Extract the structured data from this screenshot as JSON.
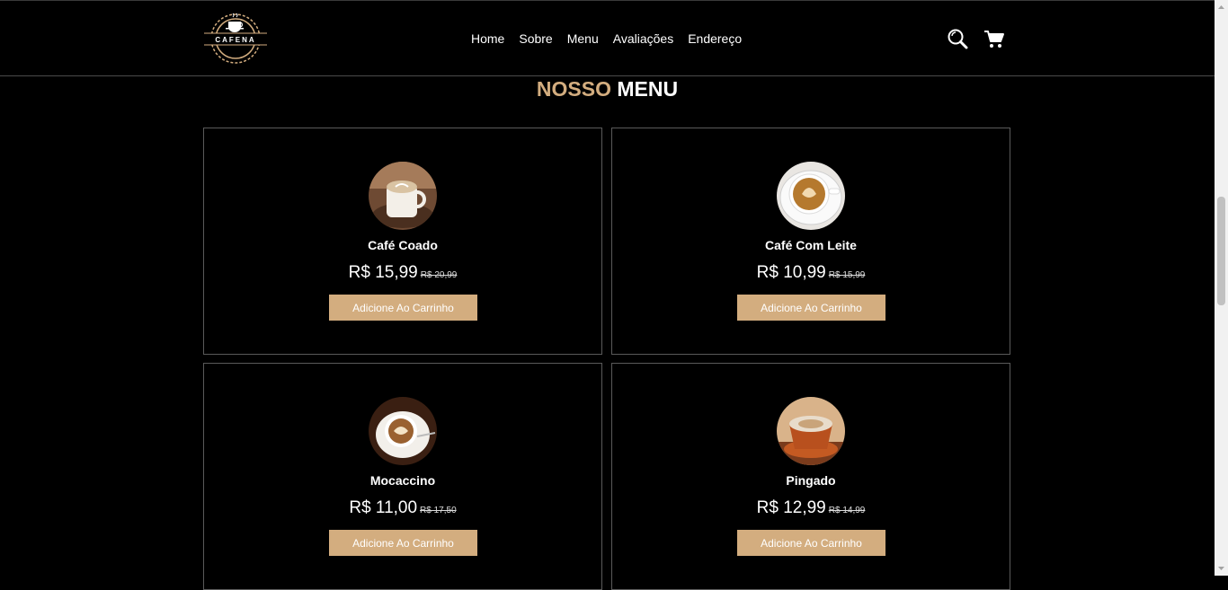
{
  "header": {
    "logo_text": "CAFENA",
    "nav": [
      "Home",
      "Sobre",
      "Menu",
      "Avaliações",
      "Endereço"
    ],
    "icons": [
      "search-icon",
      "cart-icon"
    ]
  },
  "section": {
    "title_accent": "NOSSO",
    "title_main": "MENU"
  },
  "menu": [
    {
      "name": "Café Coado",
      "price": "R$ 15,99",
      "old_price": "R$ 20,99",
      "button": "Adicione Ao Carrinho"
    },
    {
      "name": "Café Com Leite",
      "price": "R$ 10,99",
      "old_price": "R$ 15,99",
      "button": "Adicione Ao Carrinho"
    },
    {
      "name": "Mocaccino",
      "price": "R$ 11,00",
      "old_price": "R$ 17,50",
      "button": "Adicione Ao Carrinho"
    },
    {
      "name": "Pingado",
      "price": "R$ 12,99",
      "old_price": "R$ 14,99",
      "button": "Adicione Ao Carrinho"
    }
  ],
  "colors": {
    "accent": "#d3ad7f",
    "background": "#000000",
    "card_border": "#5a5a5a"
  }
}
